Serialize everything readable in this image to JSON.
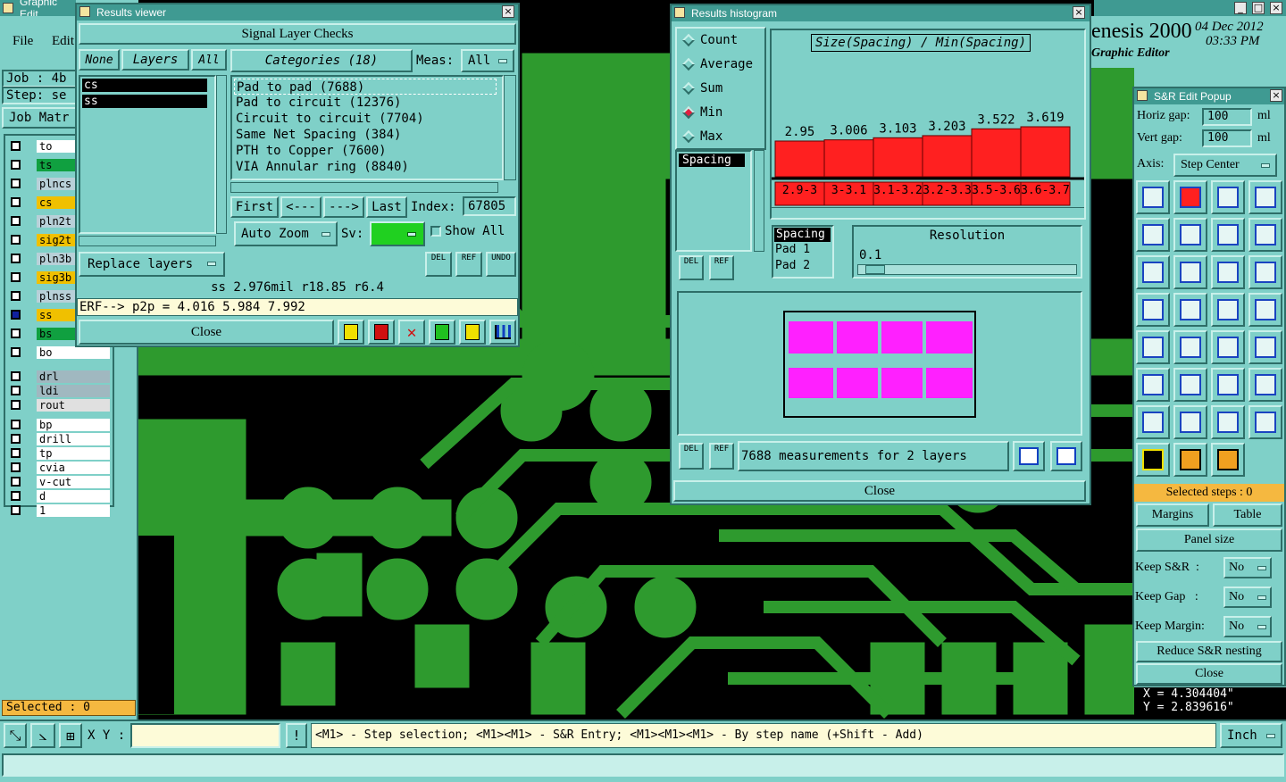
{
  "main": {
    "title": "Graphic Edit",
    "menu": [
      "File",
      "Edit"
    ],
    "job_label": "Job : 4b",
    "step_label": "Step: se",
    "job_matrix": "Job Matr",
    "brand": "enesis 2000",
    "brand_sub": "Graphic Editor",
    "date": "04 Dec 2012",
    "time": "03:33 PM",
    "selected": "Selected : 0",
    "xy_label": "X Y :",
    "status_hint": "<M1> - Step selection; <M1><M1> - S&R Entry; <M1><M1><M1> - By step name (+Shift - Add)",
    "units": "Inch",
    "coord_x": "X = 4.304404\"",
    "coord_y": "Y = 2.839616\""
  },
  "layers": [
    {
      "name": "to",
      "color": "#ffffff"
    },
    {
      "name": "ts",
      "color": "#10a040"
    },
    {
      "name": "plncs",
      "color": "#b8d0d8"
    },
    {
      "name": "cs",
      "color": "#f0c000"
    },
    {
      "name": "pln2t",
      "color": "#b8d0d8"
    },
    {
      "name": "sig2t",
      "color": "#f0c000"
    },
    {
      "name": "pln3b",
      "color": "#b8d0d8"
    },
    {
      "name": "sig3b",
      "color": "#f0c000"
    },
    {
      "name": "plnss",
      "color": "#b8d0d8"
    },
    {
      "name": "ss",
      "color": "#f0c000"
    },
    {
      "name": "bs",
      "color": "#10a040"
    },
    {
      "name": "bo",
      "color": "#ffffff"
    },
    {
      "name": "drl",
      "color": "#a0b8c0"
    },
    {
      "name": "ldi",
      "color": "#a0b8c0"
    },
    {
      "name": "rout",
      "color": "#e0e0e0"
    },
    {
      "name": "bp",
      "color": "#ffffff"
    },
    {
      "name": "drill",
      "color": "#ffffff"
    },
    {
      "name": "tp",
      "color": "#ffffff"
    },
    {
      "name": "cvia",
      "color": "#ffffff"
    },
    {
      "name": "v-cut",
      "color": "#ffffff"
    },
    {
      "name": "d",
      "color": "#ffffff"
    },
    {
      "name": "1",
      "color": "#ffffff"
    }
  ],
  "results_viewer": {
    "title": "Results viewer",
    "header": "Signal Layer Checks",
    "btn_none": "None",
    "btn_layers": "Layers",
    "btn_all": "All",
    "layer_list": [
      "cs",
      "ss"
    ],
    "categories_label": "Categories (18)",
    "meas_label": "Meas:",
    "meas_value": "All",
    "categories": [
      "Pad to pad (7688)",
      "Pad to circuit (12376)",
      "Circuit to circuit (7704)",
      "Same Net Spacing (384)",
      "PTH to Copper (7600)",
      "VIA Annular ring (8840)"
    ],
    "nav_first": "First",
    "nav_prev": "<---",
    "nav_next": "--->",
    "nav_last": "Last",
    "index_label": "Index:",
    "index_value": "67805",
    "auto_zoom": "Auto Zoom",
    "sv_label": "Sv:",
    "show_all": "Show All",
    "replace_layers": "Replace layers",
    "del": "DEL",
    "ref": "REF",
    "undo": "UNDO",
    "measure_line": "ss 2.976mil  r18.85  r6.4",
    "erf_line": "ERF--> p2p = 4.016 5.984 7.992",
    "close": "Close"
  },
  "histogram": {
    "title": "Results histogram",
    "stats": [
      "Count",
      "Average",
      "Sum",
      "Min",
      "Max"
    ],
    "selected_stat": "Min",
    "chart_title": "Size(Spacing) / Min(Spacing)",
    "field_list": [
      "Spacing"
    ],
    "axis_fields": [
      "Spacing",
      "Pad 1",
      "Pad 2"
    ],
    "resolution_label": "Resolution",
    "resolution_value": "0.1",
    "del": "DEL",
    "ref": "REF",
    "measurements": "7688 measurements for 2 layers",
    "close": "Close"
  },
  "chart_data": {
    "type": "bar",
    "title": "Size(Spacing) / Min(Spacing)",
    "categories": [
      "2.9-3",
      "3-3.1",
      "3.1-3.2",
      "3.2-3.3",
      "3.5-3.6",
      "3.6-3.7"
    ],
    "values": [
      2.95,
      3.006,
      3.103,
      3.203,
      3.522,
      3.619
    ],
    "colors": {
      "bar": "#ff2020"
    }
  },
  "sr_popup": {
    "title": "S&R Edit Popup",
    "horiz_gap_label": "Horiz gap:",
    "horiz_gap_value": "100",
    "vert_gap_label": "Vert  gap:",
    "vert_gap_value": "100",
    "unit": "ml",
    "axis_label": "Axis:",
    "axis_value": "Step Center",
    "selected_steps": "Selected steps : 0",
    "margins": "Margins",
    "table": "Table",
    "panel_size": "Panel size",
    "keep_sr_label": "Keep S&R  :",
    "keep_sr": "No",
    "keep_gap_label": "Keep Gap   :",
    "keep_gap": "No",
    "keep_margin_label": "Keep Margin:",
    "keep_margin": "No",
    "reduce": "Reduce S&R nesting",
    "close": "Close"
  }
}
